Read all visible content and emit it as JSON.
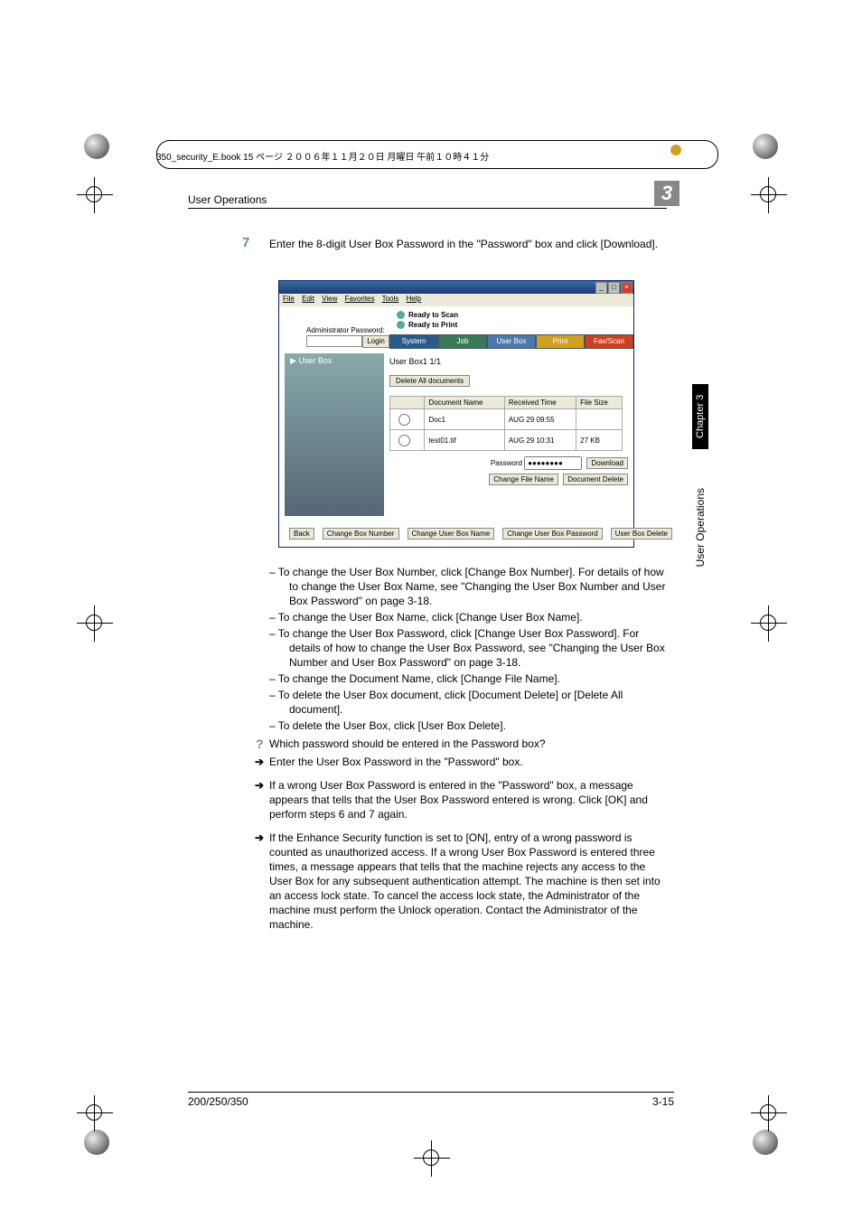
{
  "printline": "350_security_E.book 15 ページ ２００６年１１月２０日 月曜日 午前１０時４１分",
  "header": {
    "section": "User Operations",
    "chapter": "3"
  },
  "side": {
    "chapter": "Chapter 3",
    "title": "User Operations"
  },
  "step": {
    "num": "7",
    "text": "Enter the 8-digit User Box Password in the \"Password\" box and click [Download]."
  },
  "win": {
    "menu": [
      "File",
      "Edit",
      "View",
      "Favorites",
      "Tools",
      "Help"
    ],
    "status": [
      "Ready to Scan",
      "Ready to Print"
    ],
    "admin": "Administrator Password:",
    "login": "Login",
    "tabs": [
      "System",
      "Job",
      "User Box",
      "Print",
      "Fax/Scan"
    ],
    "side": "▶ User Box",
    "boxtitle": "User Box1  1/1",
    "delall": "Delete All documents",
    "cols": [
      "",
      "Document Name",
      "Received Time",
      "File Size"
    ],
    "rows": [
      [
        "Doc1",
        "AUG 29 09:55",
        ""
      ],
      [
        "test01.tif",
        "AUG 29 10:31",
        "27 KB"
      ]
    ],
    "pwlabel": "Password",
    "pwval": "●●●●●●●●",
    "btns": {
      "download": "Download",
      "chfile": "Change File Name",
      "docdel": "Document Delete"
    },
    "bbtns": [
      "Back",
      "Change Box Number",
      "Change User Box Name",
      "Change User Box Password",
      "User Box Delete"
    ]
  },
  "body": [
    "– To change the User Box Number, click [Change Box Number]. For details of how to change the User Box Name, see \"Changing the User Box Number and User Box Password\" on page 3-18.",
    "– To change the User Box Name, click [Change User Box Name].",
    "– To change the User Box Password, click [Change User Box Password]. For details of how to change the User Box Password, see \"Changing the User Box Number and User Box Password\" on page 3-18.",
    "– To change the Document Name, click [Change File Name].",
    "– To delete the User Box document, click [Document Delete] or [Delete All document].",
    "– To delete the User Box, click [User Box Delete]."
  ],
  "q": "Which password should be entered in the Password box?",
  "a1": "Enter the User Box Password in the \"Password\" box.",
  "a2": "If a wrong User Box Password is entered in the \"Password\" box, a message appears that tells that the User Box Password entered is wrong. Click [OK] and perform steps 6 and 7 again.",
  "a3": "If the Enhance Security function is set to [ON], entry of a wrong password is counted as unauthorized access. If a wrong User Box Password is entered three times, a message appears that tells that the machine rejects any access to the User Box for any subsequent authentication attempt. The machine is then set into an access lock state. To cancel the access lock state, the Administrator of the machine must perform the Unlock operation. Contact the Administrator of the machine.",
  "footer": {
    "left": "200/250/350",
    "right": "3-15"
  }
}
